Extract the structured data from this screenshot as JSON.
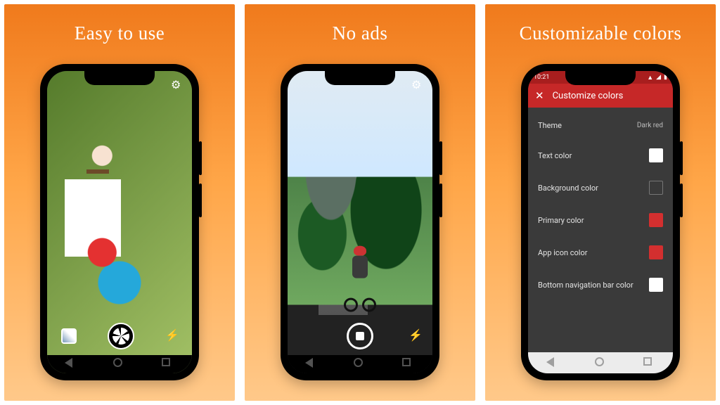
{
  "panels": [
    {
      "title": "Easy to use"
    },
    {
      "title": "No ads"
    },
    {
      "title": "Customizable colors"
    }
  ],
  "camera1": {
    "settings_icon": "gear-icon",
    "gallery_icon": "gallery-thumbnail",
    "shutter_icon": "shutter-button",
    "flash_icon": "flash-off-icon"
  },
  "camera2": {
    "settings_icon": "gear-icon",
    "record_icon": "record-stop-button",
    "flash_icon": "flash-off-icon"
  },
  "settings": {
    "status_time": "10:21",
    "app_bar_title": "Customize colors",
    "rows": [
      {
        "label": "Theme",
        "value_text": "Dark red"
      },
      {
        "label": "Text color",
        "swatch": "#ffffff"
      },
      {
        "label": "Background color",
        "swatch": "#3a3a3a",
        "border": "#777"
      },
      {
        "label": "Primary color",
        "swatch": "#d32f2f"
      },
      {
        "label": "App icon color",
        "swatch": "#d32f2f"
      },
      {
        "label": "Bottom navigation bar color",
        "swatch": "#ffffff"
      }
    ]
  }
}
